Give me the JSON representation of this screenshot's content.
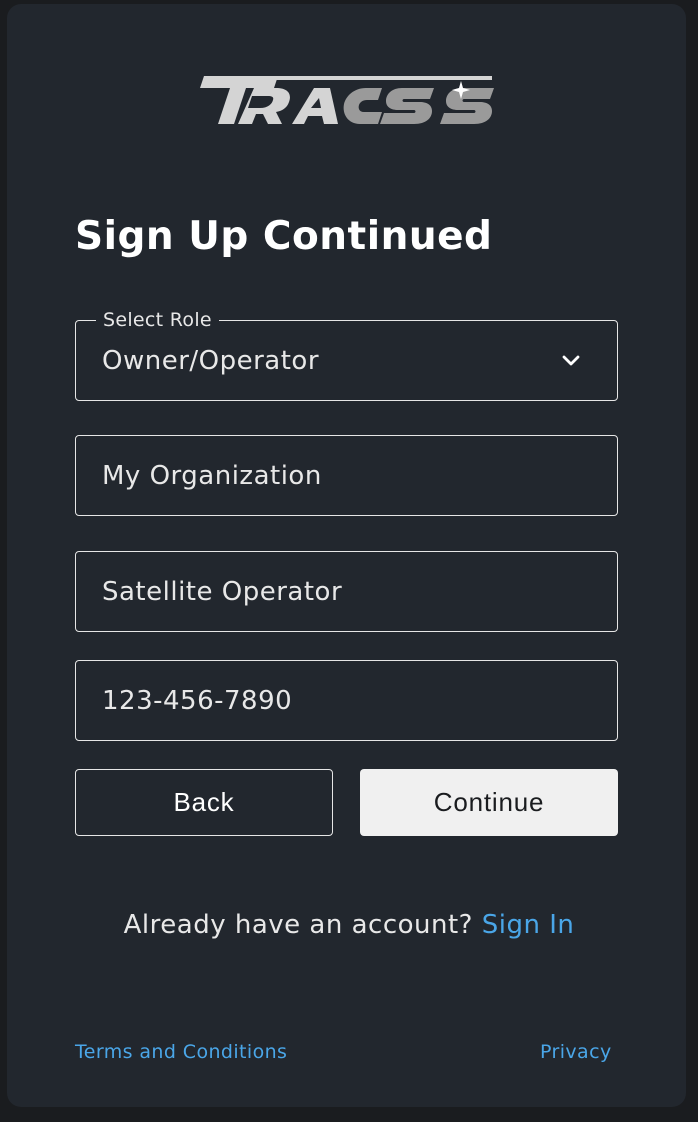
{
  "brand": {
    "logo_text": "TRACSS"
  },
  "page": {
    "title": "Sign Up Continued"
  },
  "form": {
    "role": {
      "legend": "Select Role",
      "value": "Owner/Operator"
    },
    "organization": {
      "value": "My Organization"
    },
    "organization_type": {
      "value": "Satellite Operator"
    },
    "phone": {
      "value": "123-456-7890"
    }
  },
  "actions": {
    "back_label": "Back",
    "continue_label": "Continue"
  },
  "signin": {
    "prompt": "Already have an account?",
    "link_label": "Sign In"
  },
  "footer": {
    "terms_label": "Terms and Conditions",
    "privacy_label": "Privacy"
  },
  "colors": {
    "background": "#22272e",
    "link": "#4aa6e8",
    "button_primary": "#f0f0f0"
  }
}
